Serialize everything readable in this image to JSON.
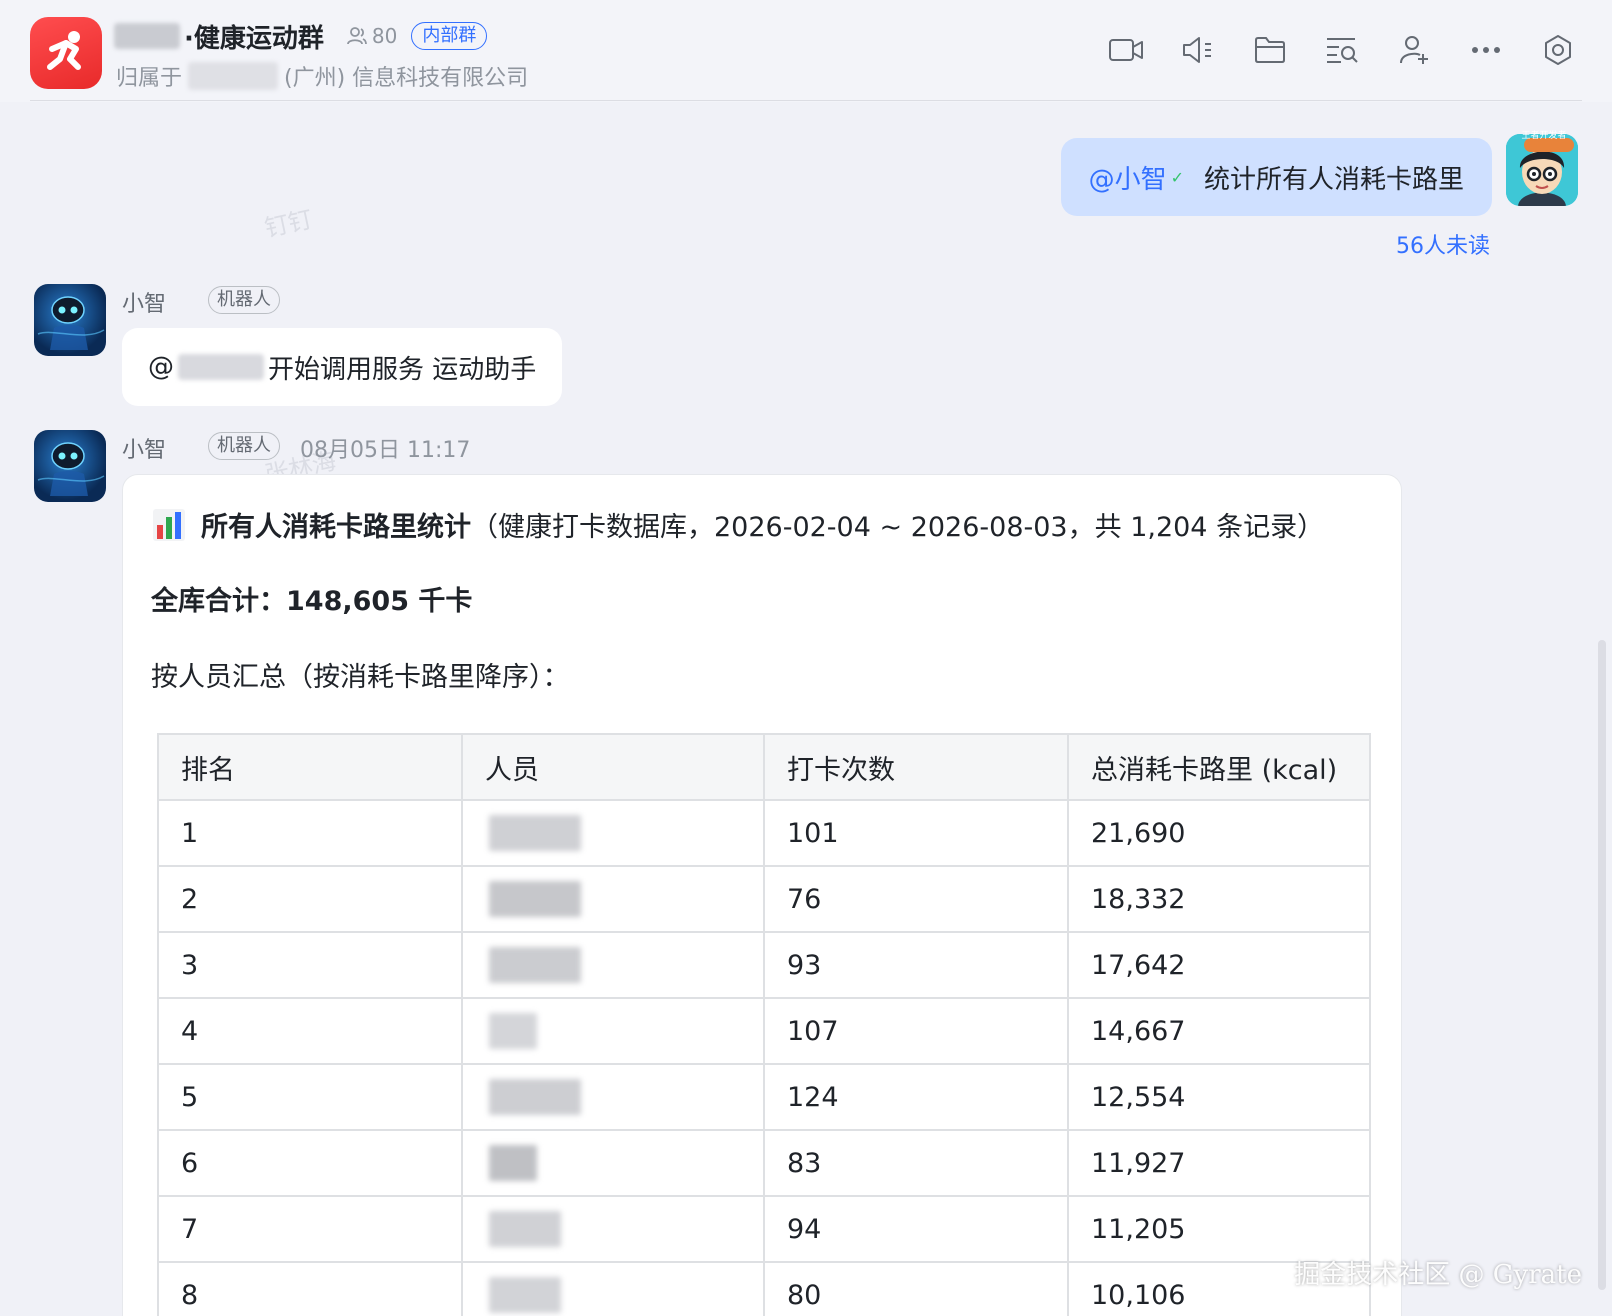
{
  "header": {
    "group_name": "·健康运动群",
    "member_count": "80",
    "internal_badge": "内部群",
    "owner_prefix": "归属于",
    "owner_suffix": "(广州) 信息科技有限公司",
    "tools": [
      "video-icon",
      "speaker-icon",
      "folder-icon",
      "search-list-icon",
      "add-member-icon",
      "more-icon",
      "settings-icon"
    ]
  },
  "watermarks": [
    "钉钉",
    "张林海"
  ],
  "outgoing": {
    "mention": "@小智",
    "text": "统计所有人消耗卡路里",
    "read_status": "56人未读",
    "avatar_badge": "王者开发者"
  },
  "bot": {
    "name": "小智",
    "tag": "机器人"
  },
  "msg1": {
    "at": "@",
    "text": "开始调用服务 运动助手"
  },
  "msg2": {
    "time": "08月05日 11:17",
    "title_bold": "所有人消耗卡路里统计",
    "title_rest": "（健康打卡数据库，2026-02-04 ~ 2026-08-03，共 1,204 条记录）",
    "total": "全库合计：148,605 千卡",
    "subtitle": "按人员汇总（按消耗卡路里降序）：",
    "table": {
      "headers": [
        "排名",
        "人员",
        "打卡次数",
        "总消耗卡路里 (kcal)"
      ],
      "rows": [
        {
          "rank": "1",
          "count": "101",
          "kcal": "21,690"
        },
        {
          "rank": "2",
          "count": "76",
          "kcal": "18,332"
        },
        {
          "rank": "3",
          "count": "93",
          "kcal": "17,642"
        },
        {
          "rank": "4",
          "count": "107",
          "kcal": "14,667"
        },
        {
          "rank": "5",
          "count": "124",
          "kcal": "12,554"
        },
        {
          "rank": "6",
          "count": "83",
          "kcal": "11,927"
        },
        {
          "rank": "7",
          "count": "94",
          "kcal": "11,205"
        },
        {
          "rank": "8",
          "count": "80",
          "kcal": "10,106"
        }
      ]
    }
  },
  "brand_watermark": "掘金技术社区 @ Gyrate",
  "colors": {
    "accent": "#3370ff",
    "out_bubble": "#cfe0ff",
    "background": "#f0f1f7",
    "logo": "#ff4d4f"
  }
}
